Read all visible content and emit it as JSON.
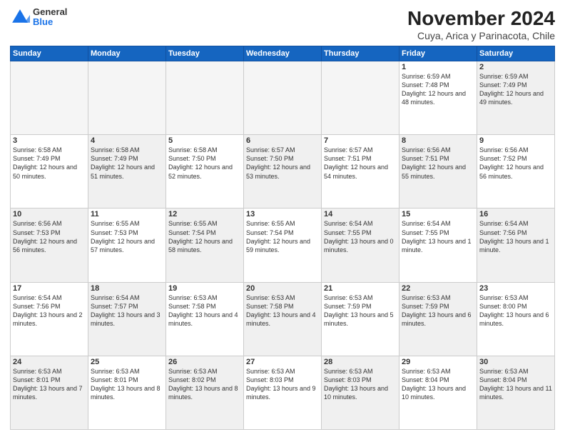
{
  "logo": {
    "general": "General",
    "blue": "Blue"
  },
  "title": "November 2024",
  "subtitle": "Cuya, Arica y Parinacota, Chile",
  "headers": [
    "Sunday",
    "Monday",
    "Tuesday",
    "Wednesday",
    "Thursday",
    "Friday",
    "Saturday"
  ],
  "weeks": [
    [
      {
        "day": "",
        "info": "",
        "empty": true
      },
      {
        "day": "",
        "info": "",
        "empty": true
      },
      {
        "day": "",
        "info": "",
        "empty": true
      },
      {
        "day": "",
        "info": "",
        "empty": true
      },
      {
        "day": "",
        "info": "",
        "empty": true
      },
      {
        "day": "1",
        "info": "Sunrise: 6:59 AM\nSunset: 7:48 PM\nDaylight: 12 hours and 48 minutes.",
        "shade": false
      },
      {
        "day": "2",
        "info": "Sunrise: 6:59 AM\nSunset: 7:49 PM\nDaylight: 12 hours and 49 minutes.",
        "shade": true
      }
    ],
    [
      {
        "day": "3",
        "info": "Sunrise: 6:58 AM\nSunset: 7:49 PM\nDaylight: 12 hours and 50 minutes.",
        "shade": false
      },
      {
        "day": "4",
        "info": "Sunrise: 6:58 AM\nSunset: 7:49 PM\nDaylight: 12 hours and 51 minutes.",
        "shade": true
      },
      {
        "day": "5",
        "info": "Sunrise: 6:58 AM\nSunset: 7:50 PM\nDaylight: 12 hours and 52 minutes.",
        "shade": false
      },
      {
        "day": "6",
        "info": "Sunrise: 6:57 AM\nSunset: 7:50 PM\nDaylight: 12 hours and 53 minutes.",
        "shade": true
      },
      {
        "day": "7",
        "info": "Sunrise: 6:57 AM\nSunset: 7:51 PM\nDaylight: 12 hours and 54 minutes.",
        "shade": false
      },
      {
        "day": "8",
        "info": "Sunrise: 6:56 AM\nSunset: 7:51 PM\nDaylight: 12 hours and 55 minutes.",
        "shade": true
      },
      {
        "day": "9",
        "info": "Sunrise: 6:56 AM\nSunset: 7:52 PM\nDaylight: 12 hours and 56 minutes.",
        "shade": false
      }
    ],
    [
      {
        "day": "10",
        "info": "Sunrise: 6:56 AM\nSunset: 7:53 PM\nDaylight: 12 hours and 56 minutes.",
        "shade": true
      },
      {
        "day": "11",
        "info": "Sunrise: 6:55 AM\nSunset: 7:53 PM\nDaylight: 12 hours and 57 minutes.",
        "shade": false
      },
      {
        "day": "12",
        "info": "Sunrise: 6:55 AM\nSunset: 7:54 PM\nDaylight: 12 hours and 58 minutes.",
        "shade": true
      },
      {
        "day": "13",
        "info": "Sunrise: 6:55 AM\nSunset: 7:54 PM\nDaylight: 12 hours and 59 minutes.",
        "shade": false
      },
      {
        "day": "14",
        "info": "Sunrise: 6:54 AM\nSunset: 7:55 PM\nDaylight: 13 hours and 0 minutes.",
        "shade": true
      },
      {
        "day": "15",
        "info": "Sunrise: 6:54 AM\nSunset: 7:55 PM\nDaylight: 13 hours and 1 minute.",
        "shade": false
      },
      {
        "day": "16",
        "info": "Sunrise: 6:54 AM\nSunset: 7:56 PM\nDaylight: 13 hours and 1 minute.",
        "shade": true
      }
    ],
    [
      {
        "day": "17",
        "info": "Sunrise: 6:54 AM\nSunset: 7:56 PM\nDaylight: 13 hours and 2 minutes.",
        "shade": false
      },
      {
        "day": "18",
        "info": "Sunrise: 6:54 AM\nSunset: 7:57 PM\nDaylight: 13 hours and 3 minutes.",
        "shade": true
      },
      {
        "day": "19",
        "info": "Sunrise: 6:53 AM\nSunset: 7:58 PM\nDaylight: 13 hours and 4 minutes.",
        "shade": false
      },
      {
        "day": "20",
        "info": "Sunrise: 6:53 AM\nSunset: 7:58 PM\nDaylight: 13 hours and 4 minutes.",
        "shade": true
      },
      {
        "day": "21",
        "info": "Sunrise: 6:53 AM\nSunset: 7:59 PM\nDaylight: 13 hours and 5 minutes.",
        "shade": false
      },
      {
        "day": "22",
        "info": "Sunrise: 6:53 AM\nSunset: 7:59 PM\nDaylight: 13 hours and 6 minutes.",
        "shade": true
      },
      {
        "day": "23",
        "info": "Sunrise: 6:53 AM\nSunset: 8:00 PM\nDaylight: 13 hours and 6 minutes.",
        "shade": false
      }
    ],
    [
      {
        "day": "24",
        "info": "Sunrise: 6:53 AM\nSunset: 8:01 PM\nDaylight: 13 hours and 7 minutes.",
        "shade": true
      },
      {
        "day": "25",
        "info": "Sunrise: 6:53 AM\nSunset: 8:01 PM\nDaylight: 13 hours and 8 minutes.",
        "shade": false
      },
      {
        "day": "26",
        "info": "Sunrise: 6:53 AM\nSunset: 8:02 PM\nDaylight: 13 hours and 8 minutes.",
        "shade": true
      },
      {
        "day": "27",
        "info": "Sunrise: 6:53 AM\nSunset: 8:03 PM\nDaylight: 13 hours and 9 minutes.",
        "shade": false
      },
      {
        "day": "28",
        "info": "Sunrise: 6:53 AM\nSunset: 8:03 PM\nDaylight: 13 hours and 10 minutes.",
        "shade": true
      },
      {
        "day": "29",
        "info": "Sunrise: 6:53 AM\nSunset: 8:04 PM\nDaylight: 13 hours and 10 minutes.",
        "shade": false
      },
      {
        "day": "30",
        "info": "Sunrise: 6:53 AM\nSunset: 8:04 PM\nDaylight: 13 hours and 11 minutes.",
        "shade": true
      }
    ]
  ]
}
